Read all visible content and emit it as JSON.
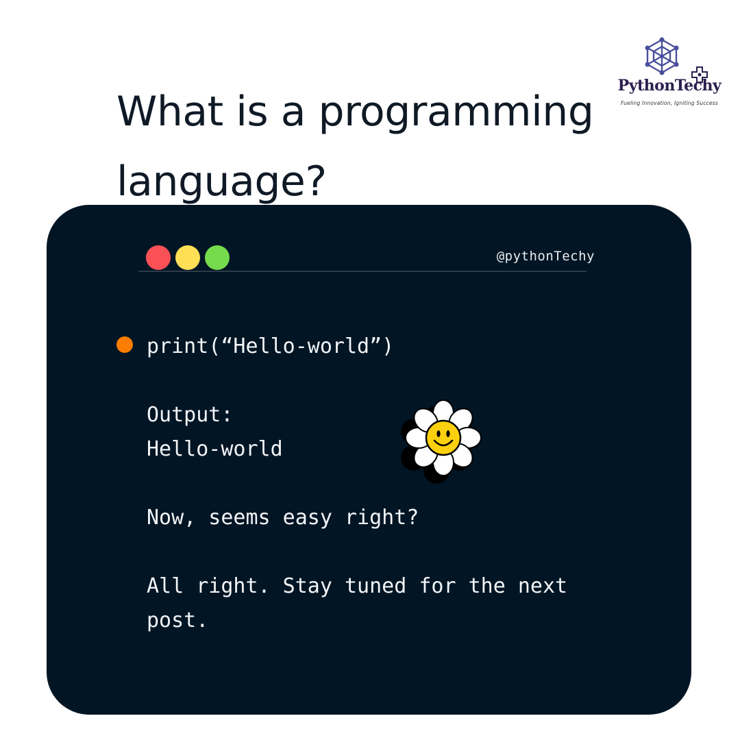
{
  "header": {
    "title_line1": "What is a programming",
    "title_line2": "language?"
  },
  "logo": {
    "icon": "network-polygon-icon",
    "name": "PythonTechy",
    "tagline": "Fueling Innovation, Igniting Success",
    "colors": {
      "mark": "#4a4f9c",
      "name": "#2b1f4f"
    }
  },
  "code_window": {
    "background": "#021524",
    "handle": "@pythonTechy",
    "window_controls": [
      {
        "name": "close",
        "color": "#fb5156"
      },
      {
        "name": "minimize",
        "color": "#fedf56"
      },
      {
        "name": "maximize",
        "color": "#76db4d"
      }
    ],
    "bullet_color": "#fd7d03",
    "lines": {
      "code": "print(“Hello-world”)",
      "output_label": "Output:",
      "output_value": "Hello-world",
      "question": "Now, seems easy right?",
      "closing": "All right. Stay tuned for the next post."
    },
    "decoration": "smiley-flower-icon"
  }
}
